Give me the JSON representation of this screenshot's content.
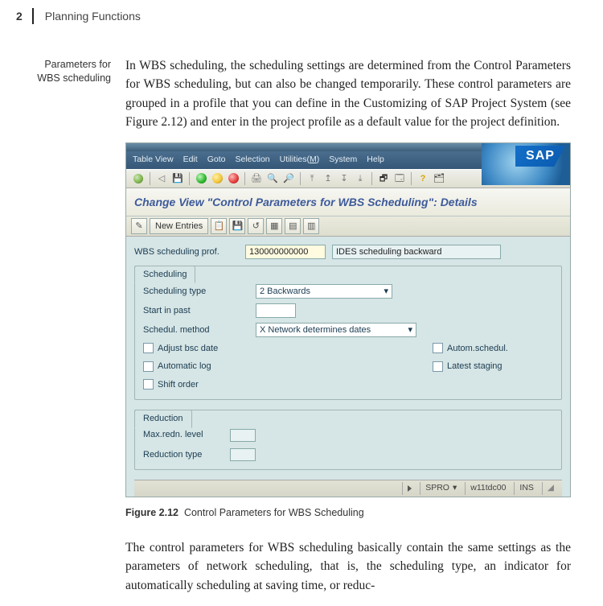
{
  "header": {
    "chapter_num": "2",
    "chapter_title": "Planning Functions"
  },
  "margin_note": {
    "line1": "Parameters for",
    "line2": "WBS scheduling"
  },
  "para1": "In WBS scheduling, the scheduling settings are determined from the Control Parameters for WBS scheduling, but can also be changed temporarily. These control parameters are grouped in a profile that you can define in the Customizing of SAP Project System (see Figure 2.12) and enter in the project profile as a default value for the project definition.",
  "menubar": {
    "m1": "Table View",
    "m2": "Edit",
    "m3": "Goto",
    "m4": "Selection",
    "m5_pre": "Utilities(",
    "m5_u": "M",
    "m5_post": ")",
    "m6": "System",
    "m7": "Help"
  },
  "logo_text": "SAP",
  "page_title": "Change View \"Control Parameters for WBS Scheduling\": Details",
  "new_entries_label": "New Entries",
  "prof_row": {
    "label": "WBS scheduling prof.",
    "code": "130000000000",
    "desc": "IDES scheduling backward"
  },
  "scheduling": {
    "tab": "Scheduling",
    "type_label": "Scheduling type",
    "type_value": "2 Backwards",
    "start_label": "Start in past",
    "method_label": "Schedul. method",
    "method_value": "X Network determines dates",
    "adjust_label": "Adjust bsc date",
    "autosched_label": "Autom.schedul.",
    "autolog_label": "Automatic log",
    "latest_label": "Latest staging",
    "shift_label": "Shift order"
  },
  "reduction": {
    "tab": "Reduction",
    "max_label": "Max.redn. level",
    "type_label": "Reduction type"
  },
  "status": {
    "code": "SPRO",
    "server": "w11tdc00",
    "mode": "INS"
  },
  "caption": {
    "fig": "Figure 2.12",
    "text": "Control Parameters for WBS Scheduling"
  },
  "para2": "The control parameters for WBS scheduling basically contain the same settings as the parameters of network scheduling, that is, the scheduling type, an indicator for automatically scheduling at saving time, or reduc-"
}
